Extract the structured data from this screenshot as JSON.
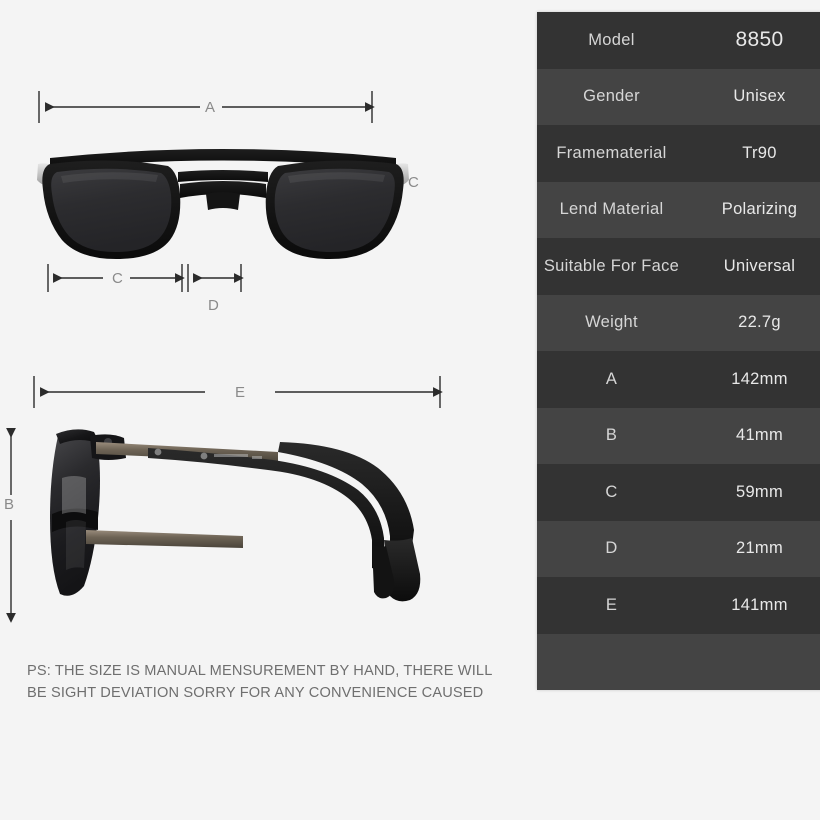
{
  "background_color": "#f4f4f4",
  "spec_table": {
    "row_colors": {
      "odd": "#333333",
      "even": "#444444"
    },
    "text_color": "#dcdcdc",
    "rows": [
      {
        "label": "Model",
        "value": "8850"
      },
      {
        "label": "Gender",
        "value": "Unisex"
      },
      {
        "label": "Framematerial",
        "value": "Tr90"
      },
      {
        "label": "Lend Material",
        "value": "Polarizing"
      },
      {
        "label": "Suitable For Face",
        "value": "Universal"
      },
      {
        "label": "Weight",
        "value": "22.7g"
      },
      {
        "label": "A",
        "value": "142mm"
      },
      {
        "label": "B",
        "value": "41mm"
      },
      {
        "label": "C",
        "value": "59mm"
      },
      {
        "label": "D",
        "value": "21mm"
      },
      {
        "label": "E",
        "value": "141mm"
      },
      {
        "label": "",
        "value": ""
      }
    ]
  },
  "front_view": {
    "dimension_labels": {
      "a": "A",
      "c_right": "C",
      "c_bottom": "C",
      "d": "D"
    }
  },
  "side_view": {
    "dimension_labels": {
      "e": "E",
      "b": "B"
    }
  },
  "disclaimer": {
    "line1": "PS:  THE SIZE IS MANUAL MENSUREMENT BY HAND, THERE WILL",
    "line2": "BE SIGHT DEVIATION SORRY FOR ANY CONVENIENCE CAUSED"
  }
}
